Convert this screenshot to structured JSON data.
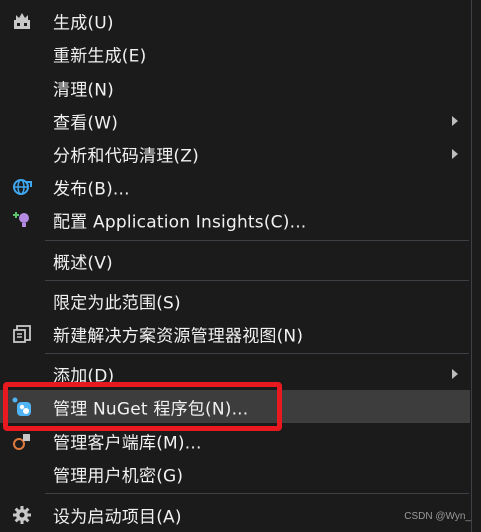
{
  "menu": {
    "items": [
      {
        "label": "生成(U)",
        "icon": "build-icon"
      },
      {
        "label": "重新生成(E)"
      },
      {
        "label": "清理(N)"
      },
      {
        "label": "查看(W)",
        "submenu": true
      },
      {
        "label": "分析和代码清理(Z)",
        "submenu": true
      },
      {
        "label": "发布(B)...",
        "icon": "publish-globe-icon"
      },
      {
        "label": "配置 Application Insights(C)...",
        "icon": "application-insights-icon"
      },
      {
        "label": "概述(V)"
      },
      {
        "label": "限定为此范围(S)"
      },
      {
        "label": "新建解决方案资源管理器视图(N)",
        "icon": "new-view-icon"
      },
      {
        "label": "添加(D)",
        "submenu": true
      },
      {
        "label": "管理 NuGet 程序包(N)...",
        "icon": "nuget-icon",
        "highlighted": true
      },
      {
        "label": "管理客户端库(M)...",
        "icon": "client-library-icon"
      },
      {
        "label": "管理用户机密(G)"
      },
      {
        "label": "设为启动项目(A)",
        "icon": "gear-icon"
      }
    ]
  },
  "colors": {
    "background": "#1b1b1c",
    "hover": "#3d3d3d",
    "text": "#f1f1f1",
    "separator": "#3f3f46",
    "annotation": "#e8191f"
  },
  "watermark": "CSDN @Wyn_"
}
